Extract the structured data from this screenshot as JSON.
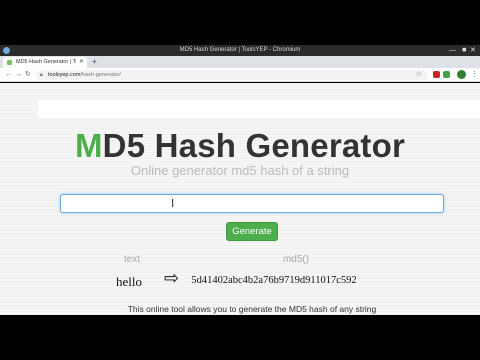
{
  "os_titlebar": {
    "title": "MD5 Hash Generator | ToolsYEP - Chromium"
  },
  "browser": {
    "tab": {
      "title": "MD5 Hash Generator | Tools",
      "favicon": "green-square-icon"
    },
    "url": {
      "host": "toolsyep.com",
      "path": "/hash-generator/"
    }
  },
  "page": {
    "heading_accent": "M",
    "heading_rest": "D5 Hash Generator",
    "subtitle": "Online generator md5 hash of a string",
    "input": {
      "value": "",
      "placeholder": ""
    },
    "generate_label": "Generate",
    "result": {
      "col_text_label": "text",
      "col_md5_label": "md5()",
      "text_value": "hello",
      "arrow": "⇨",
      "md5_value": "5d41402abc4b2a76b9719d911017c592"
    },
    "description": "This online tool allows you to generate the MD5 hash of any string"
  },
  "colors": {
    "accent": "#4cae4c",
    "input_focus": "#66afe9"
  }
}
